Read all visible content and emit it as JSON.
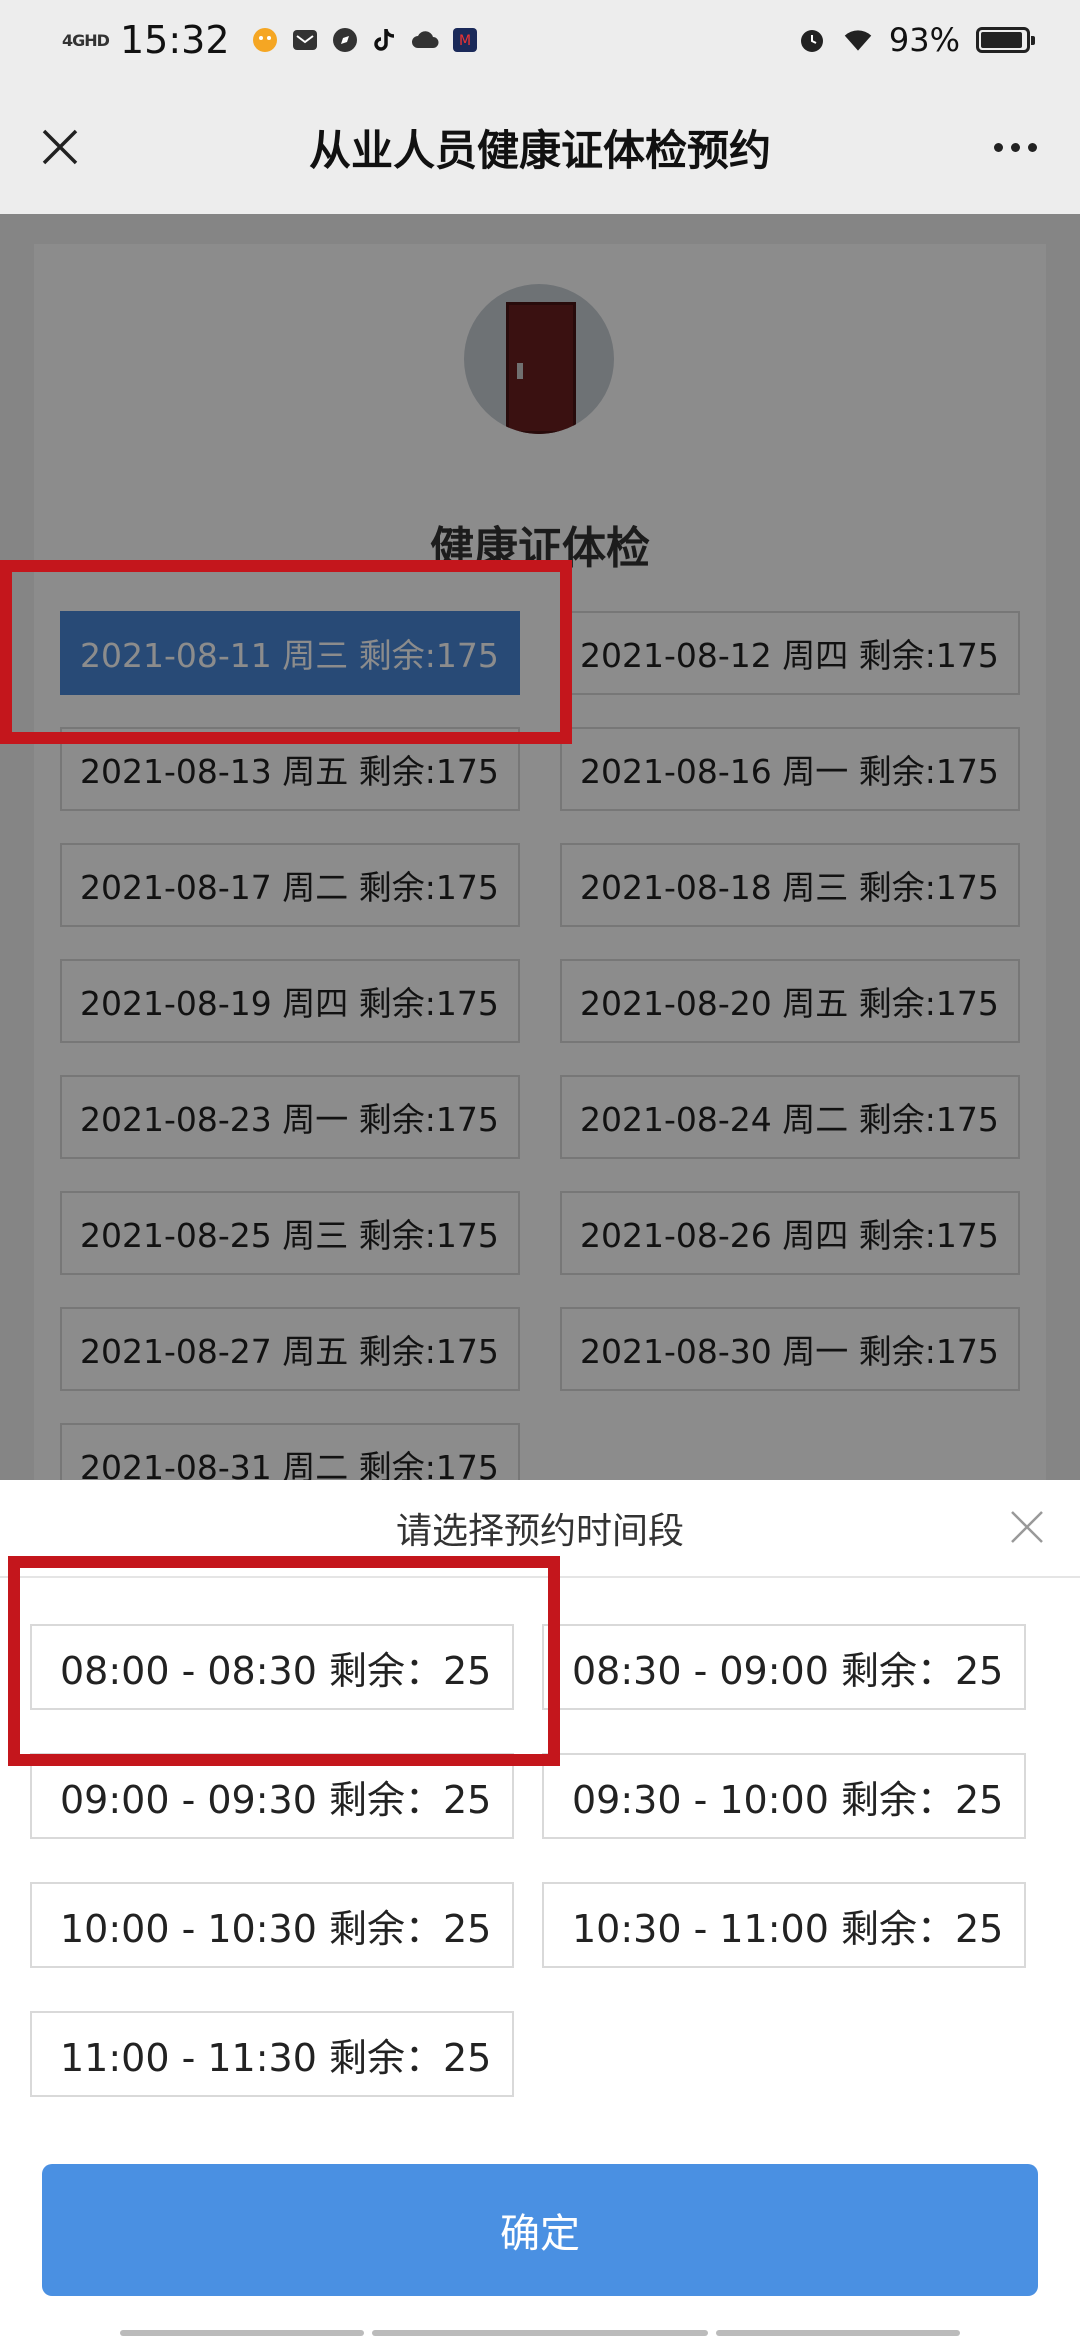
{
  "status_bar": {
    "network": "4GHD",
    "time": "15:32",
    "battery_percent": "93%",
    "battery_level": 0.93
  },
  "header": {
    "title": "从业人员健康证体检预约",
    "close_icon": "close-icon",
    "more_icon": "more-icon"
  },
  "card": {
    "title": "健康证体检"
  },
  "dates": [
    {
      "label": "2021-08-11 周三 剩余:175",
      "selected": true
    },
    {
      "label": "2021-08-12 周四 剩余:175",
      "selected": false
    },
    {
      "label": "2021-08-13 周五 剩余:175",
      "selected": false
    },
    {
      "label": "2021-08-16 周一 剩余:175",
      "selected": false
    },
    {
      "label": "2021-08-17 周二 剩余:175",
      "selected": false
    },
    {
      "label": "2021-08-18 周三 剩余:175",
      "selected": false
    },
    {
      "label": "2021-08-19 周四 剩余:175",
      "selected": false
    },
    {
      "label": "2021-08-20 周五 剩余:175",
      "selected": false
    },
    {
      "label": "2021-08-23 周一 剩余:175",
      "selected": false
    },
    {
      "label": "2021-08-24 周二 剩余:175",
      "selected": false
    },
    {
      "label": "2021-08-25 周三 剩余:175",
      "selected": false
    },
    {
      "label": "2021-08-26 周四 剩余:175",
      "selected": false
    },
    {
      "label": "2021-08-27 周五 剩余:175",
      "selected": false
    },
    {
      "label": "2021-08-30 周一 剩余:175",
      "selected": false
    },
    {
      "label": "2021-08-31 周二 剩余:175",
      "selected": false
    }
  ],
  "sheet": {
    "title": "请选择预约时间段",
    "slots": [
      {
        "label": "08:00 - 08:30 剩余：25"
      },
      {
        "label": "08:30 - 09:00 剩余：25"
      },
      {
        "label": "09:00 - 09:30 剩余：25"
      },
      {
        "label": "09:30 - 10:00 剩余：25"
      },
      {
        "label": "10:00 - 10:30 剩余：25"
      },
      {
        "label": "10:30 - 11:00 剩余：25"
      },
      {
        "label": "11:00 - 11:30 剩余：25"
      }
    ],
    "confirm_label": "确定"
  },
  "colors": {
    "accent": "#4a90e2",
    "selected_date": "#4a88d8",
    "annotation": "#c4161c"
  }
}
